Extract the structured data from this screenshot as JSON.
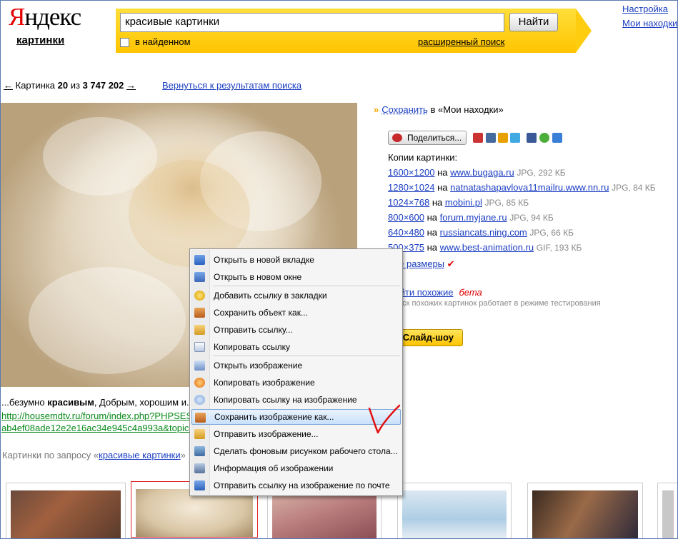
{
  "header": {
    "logo_first": "Я",
    "logo_rest": "ндекс",
    "logo_sub": "картинки",
    "search_value": "красивые картинки",
    "find_label": "Найти",
    "in_found_label": "в найденном",
    "advanced_label": "расширенный поиск",
    "settings_link": "Настройка",
    "my_finds_link": "Мои находки"
  },
  "nav": {
    "prev_arrow": "←",
    "picture_prefix": "Картинка",
    "current": "20",
    "of": "из",
    "total": "3 747 202",
    "next_arrow": "→",
    "back_link": "Вернуться к результатам поиска"
  },
  "image": {
    "caption_pre": "...безумно ",
    "caption_bold": "красивым",
    "caption_post": ", Добрым, хорошим и...",
    "source_line1": "http://housemdtv.ru/forum/index.php?PHPSESSID=",
    "source_line2": "ab4ef08ade12e2e16ac34e945c4a993a&topic=",
    "query_prefix": "Картинки по запросу «",
    "query_link": "красивые картинки",
    "query_suffix": "»"
  },
  "sidebar": {
    "save_chevron": "»",
    "save_link": "Сохранить",
    "save_suffix": " в «Мои находки»",
    "share_label": "Поделиться...",
    "copies_title": "Копии картинки:",
    "copies": [
      {
        "size": "1600×1200",
        "on": "на",
        "site": "www.bugaga.ru",
        "meta": "JPG, 292 КБ"
      },
      {
        "size": "1280×1024",
        "on": "на",
        "site": "natnatashapavlova11mailru.www.nn.ru",
        "meta": "JPG, 84 КБ"
      },
      {
        "size": "1024×768",
        "on": "на",
        "site": "mobini.pl",
        "meta": "JPG, 85 КБ"
      },
      {
        "size": "800×600",
        "on": "на",
        "site": "forum.myjane.ru",
        "meta": "JPG, 94 КБ"
      },
      {
        "size": "640×480",
        "on": "на",
        "site": "russiancats.ning.com",
        "meta": "JPG, 66 КБ"
      },
      {
        "size": "500×375",
        "on": "на",
        "site": "www.best-animation.ru",
        "meta": "GIF, 193 КБ"
      }
    ],
    "all_sizes": "Все размеры",
    "find_similar": "Найти похожие",
    "beta": "бета",
    "testing_note": "Поиск похожих картинок работает в режиме тестирования",
    "slideshow": "Слайд-шоу"
  },
  "context_menu": {
    "items": [
      {
        "label": "Открыть в новой вкладке",
        "icon": "new-tab-icon"
      },
      {
        "label": "Открыть в новом окне",
        "icon": "new-window-icon"
      },
      {
        "label": "Добавить ссылку в закладки",
        "icon": "bookmark-icon"
      },
      {
        "label": "Сохранить объект как...",
        "icon": "save-object-icon"
      },
      {
        "label": "Отправить ссылку...",
        "icon": "send-link-icon"
      },
      {
        "label": "Копировать ссылку",
        "icon": "copy-link-icon"
      },
      {
        "label": "Открыть изображение",
        "icon": "open-image-icon"
      },
      {
        "label": "Копировать изображение",
        "icon": "copy-image-icon"
      },
      {
        "label": "Копировать ссылку на изображение",
        "icon": "copy-image-link-icon"
      },
      {
        "label": "Сохранить изображение как...",
        "icon": "save-image-icon"
      },
      {
        "label": "Отправить изображение...",
        "icon": "send-image-icon"
      },
      {
        "label": "Сделать фоновым рисунком рабочего стола...",
        "icon": "wallpaper-icon"
      },
      {
        "label": "Информация об изображении",
        "icon": "image-info-icon"
      },
      {
        "label": "Отправить ссылку на изображение по почте",
        "icon": "mail-icon"
      }
    ],
    "highlighted_index": 9
  },
  "colors": {
    "link": "#1a3dc1",
    "yandex_red": "#e30000",
    "search_yellow": "#ffcd10",
    "annotation_red": "#e01010"
  }
}
